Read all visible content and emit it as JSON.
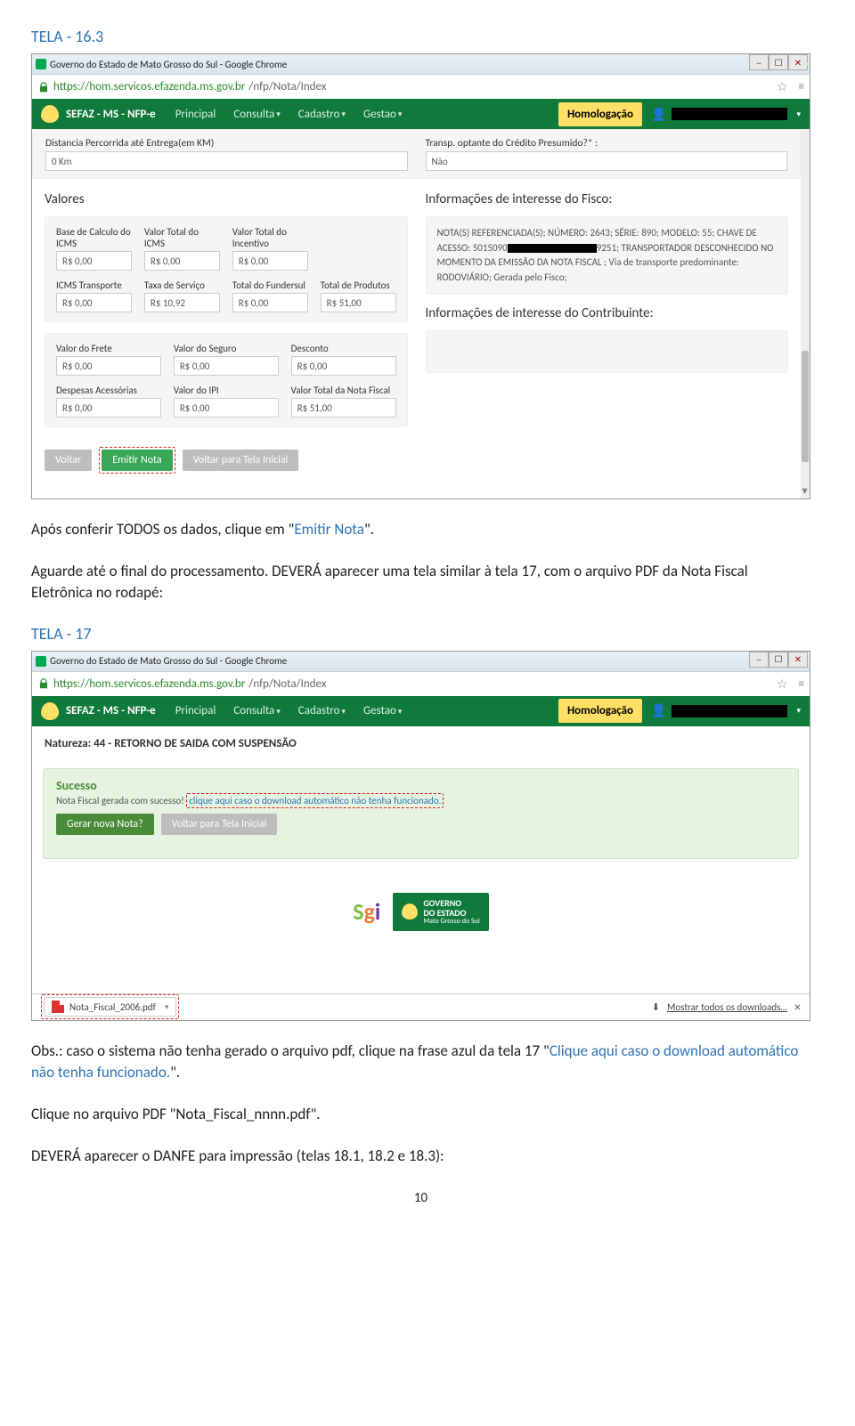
{
  "headers": {
    "tela163": "TELA - 16.3",
    "tela17": "TELA - 17"
  },
  "browser": {
    "title": "Governo do Estado de Mato Grosso do Sul - Google Chrome",
    "url_host": "https://hom.servicos.efazenda.ms.gov.br",
    "url_path": "/nfp/Nota/Index"
  },
  "app": {
    "brand": "SEFAZ - MS - NFP-e",
    "nav": [
      "Principal",
      "Consulta",
      "Cadastro",
      "Gestao"
    ],
    "homolog": "Homologação"
  },
  "tela163": {
    "dist_label": "Distancia Percorrida até Entrega(em KM)",
    "dist_value": "0 Km",
    "transp_label": "Transp. optante do Crédito Presumido?* :",
    "transp_value": "Não",
    "sec_valores": "Valores",
    "sec_fisco": "Informações de interesse do Fisco:",
    "sec_contrib": "Informações de interesse do Contribuinte:",
    "row1": {
      "base_label": "Base de Calculo do ICMS",
      "base_val": "R$ 0,00",
      "vticm_label": "Valor Total do ICMS",
      "vticm_val": "R$ 0,00",
      "vtinc_label": "Valor Total do Incentivo",
      "vtinc_val": "R$ 0,00"
    },
    "row2": {
      "icmst_label": "ICMS Transporte",
      "icmst_val": "R$ 0,00",
      "ts_label": "Taxa de Serviço",
      "ts_val": "R$ 10,92",
      "tf_label": "Total do Fundersul",
      "tf_val": "R$ 0,00",
      "tp_label": "Total de Produtos",
      "tp_val": "R$ 51,00"
    },
    "row3": {
      "frete_label": "Valor do Frete",
      "frete_val": "R$ 0,00",
      "seg_label": "Valor do Seguro",
      "seg_val": "R$ 0,00",
      "desc_label": "Desconto",
      "desc_val": "R$ 0,00"
    },
    "row4": {
      "da_label": "Despesas Acessórias",
      "da_val": "R$ 0,00",
      "ipi_label": "Valor do IPI",
      "ipi_val": "R$ 0,00",
      "vtnf_label": "Valor Total da Nota Fiscal",
      "vtnf_val": "R$ 51,00"
    },
    "fisco_text_pre": "NOTA(S) REFERENCIADA(S); NÚMERO: 2643; SÉRIE: 890; MODELO: 55; CHAVE DE ACESSO: 5015090",
    "fisco_text_post": "9251; TRANSPORTADOR DESCONHECIDO NO MOMENTO DA EMISSÃO DA NOTA FISCAL ; Via de transporte predominante: RODOVIÁRIO; Gerada pelo Fisco;",
    "btn_voltar": "Voltar",
    "btn_emitir": "Emitir Nota",
    "btn_voltar_inicial": "Voltar para Tela Inicial"
  },
  "body1": {
    "p1_pre": "Após conferir TODOS os dados, clique em \"",
    "p1_link": "Emitir Nota",
    "p1_post": "\".",
    "p2": "Aguarde até o final do processamento. DEVERÁ aparecer uma tela similar à tela 17, com o arquivo PDF da Nota Fiscal Eletrônica no rodapé:"
  },
  "tela17": {
    "natureza": "Natureza: 44 - RETORNO DE SAIDA COM SUSPENSÃO",
    "success_title": "Sucesso",
    "success_pre": "Nota Fiscal gerada com sucesso!",
    "success_link": "clique aqui caso o download automático não tenha funcionado.",
    "btn_gerar": "Gerar nova Nota?",
    "btn_voltar_inicial": "Voltar para Tela Inicial",
    "gov_line1": "GOVERNO",
    "gov_line2": "DO ESTADO",
    "gov_line3": "Mato Grosso do Sul",
    "dl_file": "Nota_Fiscal_2006.pdf",
    "dl_all": "Mostrar todos os downloads…"
  },
  "body2": {
    "obs_pre": "Obs.: caso o sistema não tenha gerado o arquivo pdf, clique na frase azul da tela 17 \"",
    "obs_link": "Clique aqui caso o download automático não tenha funcionado.",
    "obs_post": "\".",
    "p3": "Clique no arquivo PDF \"Nota_Fiscal_nnnn.pdf\".",
    "p4": "DEVERÁ aparecer o DANFE para impressão (telas 18.1, 18.2 e 18.3):"
  },
  "pagenum": "10"
}
